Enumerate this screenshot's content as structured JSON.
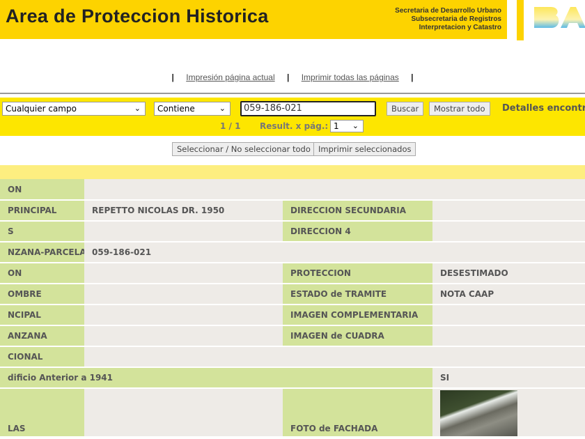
{
  "header": {
    "title": "Area de Proteccion Historica",
    "secretaria": [
      "Secretaria de Desarrollo Urbano",
      "Subsecretaria de Registros",
      "Interpretacion y Catastro"
    ],
    "logo": "BA"
  },
  "links": {
    "sep": "|",
    "print_current": "Impresión página actual",
    "print_all": "Imprimir todas las páginas"
  },
  "search": {
    "field": "Cualquier campo",
    "operator": "Contiene",
    "value": "059-186-021",
    "search_btn": "Buscar",
    "show_all_btn": "Mostrar todo",
    "details": "Detalles encontrados",
    "page": "1 / 1",
    "per_page_label": "Result. x pág.:",
    "per_page": "1"
  },
  "actions": {
    "select_all": "Seleccionar / No seleccionar todo",
    "print_selected": "Imprimir seleccionados"
  },
  "rows": [
    {
      "label": "ON",
      "value": ""
    },
    {
      "label": "PRINCIPAL",
      "value": "REPETTO NICOLAS DR. 1950",
      "label2": "DIRECCION SECUNDARIA",
      "value2": ""
    },
    {
      "label": "S",
      "value": "",
      "label2": "DIRECCION 4",
      "value2": ""
    },
    {
      "label": "NZANA-PARCELA",
      "value": "059-186-021"
    },
    {
      "label": "ON",
      "value": "",
      "label2": "PROTECCION",
      "value2": "DESESTIMADO"
    },
    {
      "label": "OMBRE",
      "value": "",
      "label2": "ESTADO de TRAMITE",
      "value2": "NOTA CAAP"
    },
    {
      "label": "NCIPAL",
      "value": "",
      "label2": "IMAGEN COMPLEMENTARIA",
      "value2": ""
    },
    {
      "label": "ANZANA",
      "value": "",
      "label2": "IMAGEN de CUADRA",
      "value2": ""
    },
    {
      "label": "CIONAL",
      "value": ""
    },
    {
      "label": "dificio Anterior a 1941",
      "value": "SI"
    },
    {
      "label": "LAS",
      "value": "",
      "label2": "FOTO de FACHADA"
    }
  ]
}
